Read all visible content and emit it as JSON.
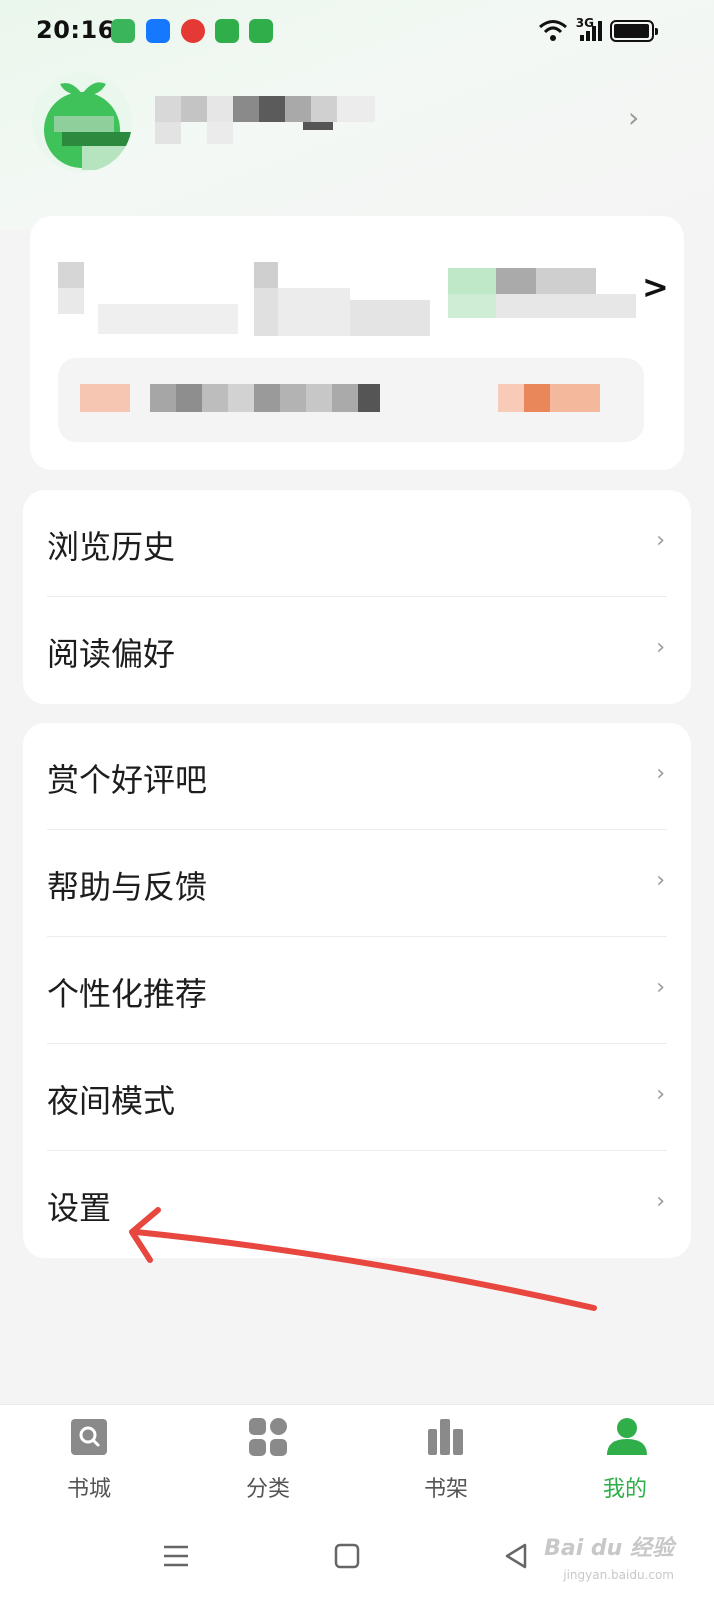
{
  "status_bar": {
    "time": "20:16",
    "network": "3G",
    "notification_icons": [
      "messages-icon",
      "alipay-icon",
      "app-badge-icon",
      "phone-icon",
      "phone-icon"
    ]
  },
  "profile": {
    "avatar_icon": "green-sprout-avatar-icon",
    "chevron": "›"
  },
  "wallet": {
    "arrow": ">"
  },
  "menu_group_1": [
    {
      "label": "浏览历史"
    },
    {
      "label": "阅读偏好"
    }
  ],
  "menu_group_2": [
    {
      "label": "赏个好评吧"
    },
    {
      "label": "帮助与反馈"
    },
    {
      "label": "个性化推荐"
    },
    {
      "label": "夜间模式"
    },
    {
      "label": "设置"
    }
  ],
  "chevron": "›",
  "tabbar": [
    {
      "label": "书城",
      "icon": "search-icon",
      "active": false
    },
    {
      "label": "分类",
      "icon": "grid-icon",
      "active": false
    },
    {
      "label": "书架",
      "icon": "bookshelf-icon",
      "active": false
    },
    {
      "label": "我的",
      "icon": "person-icon",
      "active": true
    }
  ],
  "colors": {
    "accent": "#2fae4a",
    "annotation": "#e8473f"
  },
  "watermark": {
    "text": "Bai du 经验",
    "sub": "jingyan.baidu.com"
  }
}
